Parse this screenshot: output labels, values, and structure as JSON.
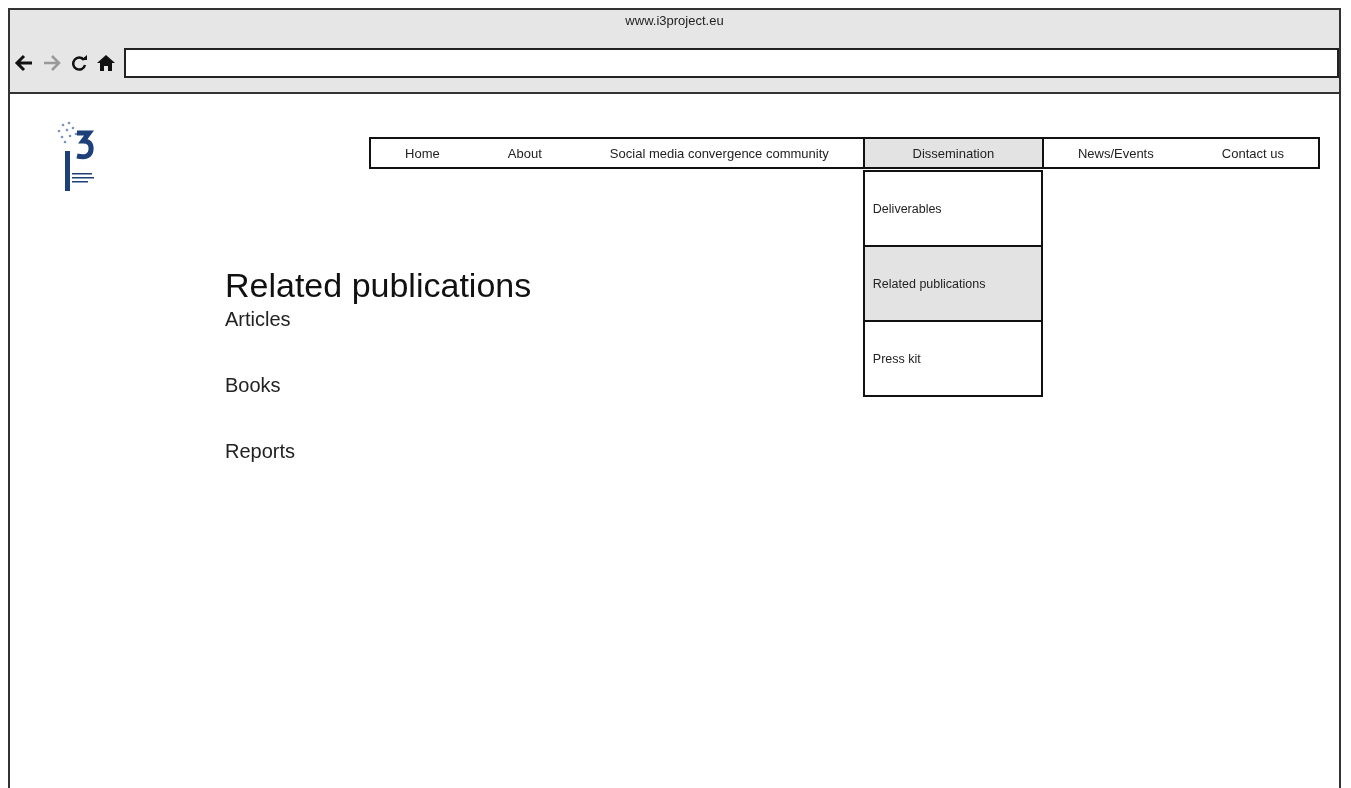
{
  "browser": {
    "url_title": "www.i3project.eu"
  },
  "nav": [
    {
      "label": "Home",
      "selected": false
    },
    {
      "label": "About",
      "selected": false
    },
    {
      "label": "Social media convergence community",
      "selected": false
    },
    {
      "label": "Dissemination",
      "selected": true,
      "submenu": [
        {
          "label": "Deliverables",
          "selected": false
        },
        {
          "label": "Related publications",
          "selected": true
        },
        {
          "label": "Press kit",
          "selected": false
        }
      ]
    },
    {
      "label": "News/Events",
      "selected": false
    },
    {
      "label": "Contact us",
      "selected": false
    }
  ],
  "content": {
    "heading": "Related publications",
    "links": [
      "Articles",
      "Books",
      "Reports"
    ]
  }
}
